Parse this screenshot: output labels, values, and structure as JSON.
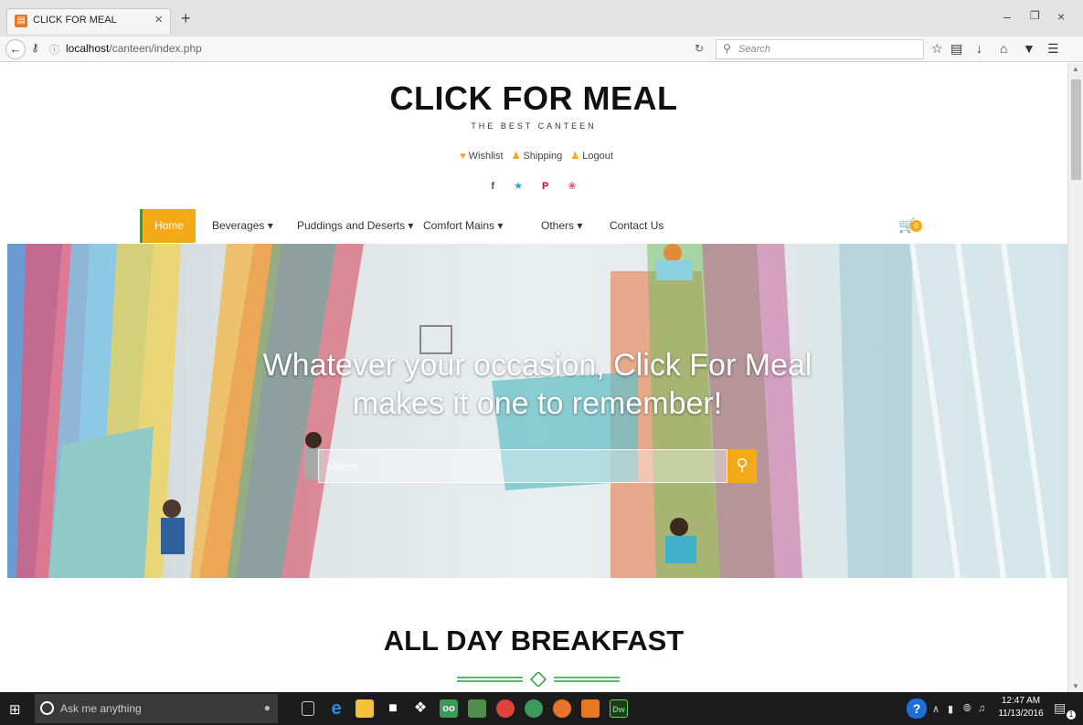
{
  "browser": {
    "tab_title": "CLICK FOR MEAL",
    "url_host": "localhost",
    "url_path": "/canteen/index.php",
    "search_placeholder": "Search"
  },
  "site": {
    "title": "CLICK FOR MEAL",
    "subtitle": "THE BEST CANTEEN",
    "toplinks": {
      "wishlist": "Wishlist",
      "shipping": "Shipping",
      "logout": "Logout"
    },
    "social": {
      "facebook": "f",
      "twitter": "★",
      "pinterest": "P",
      "dribbble": "❀"
    },
    "nav": {
      "home": "Home",
      "beverages": "Beverages ▾",
      "puddings": "Puddings and Deserts ▾",
      "comfort": "Comfort Mains ▾",
      "others": "Others ▾",
      "contact": "Contact Us",
      "cart_count": "0"
    },
    "hero": {
      "line1": "Whatever your occasion, Click For Meal",
      "line2": "makes it one to remember!",
      "search_placeholder": "search"
    },
    "section_title": "ALL DAY BREAKFAST"
  },
  "taskbar": {
    "cortana_placeholder": "Ask me anything",
    "time": "12:47 AM",
    "date": "11/13/2016",
    "notification_count": "1"
  },
  "colors": {
    "accent": "#f4a916",
    "green": "#2e9e46"
  }
}
